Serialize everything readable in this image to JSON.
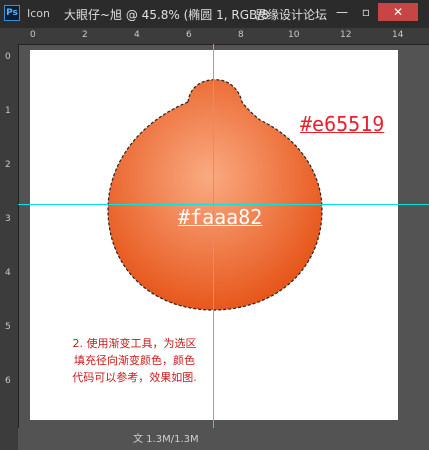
{
  "titlebar": {
    "app_icon": "Ps",
    "short_title": "Icon",
    "document_title": "大眼仔~旭 @ 45.8% (椭圆 1, RGB/8",
    "minimize_icon": "minimize-icon",
    "maximize_icon": "maximize-icon",
    "close_icon": "close-icon",
    "minimize_glyph": "—",
    "maximize_glyph": "▫",
    "close_glyph": "✕"
  },
  "watermark": "思缘设计论坛",
  "rulers": {
    "top": [
      "0",
      "2",
      "4",
      "6",
      "8",
      "10",
      "12",
      "14"
    ],
    "left": [
      "0",
      "1",
      "2",
      "3",
      "4",
      "5",
      "6"
    ]
  },
  "canvas": {
    "hex_outer": "#e65519",
    "hex_center": "#faaa82",
    "note_line1": "2. 使用渐变工具，为选区",
    "note_line2": "填充径向渐变颜色，颜色",
    "note_line3": "代码可以参考，效果如图.",
    "gradient_colors": {
      "center": "#faaa82",
      "edge": "#e65519"
    }
  },
  "statusbar": {
    "text": "文    1.3M/1.3M"
  }
}
